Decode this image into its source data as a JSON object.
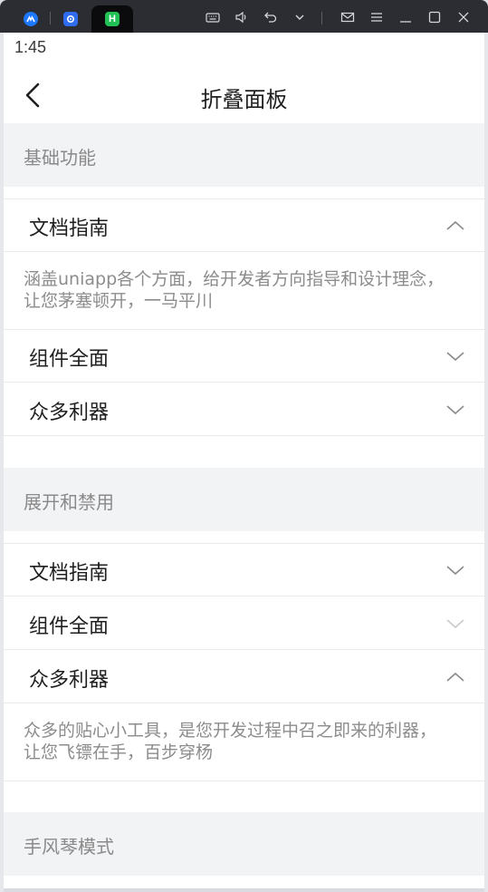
{
  "window": {
    "tab_active_letter": "H",
    "accent_colors": {
      "tab1": "#1e78ff",
      "tab2": "#2f6cf0",
      "tab3": "#21c156"
    }
  },
  "status": {
    "time": "1:45"
  },
  "navbar": {
    "title": "折叠面板"
  },
  "sections": [
    {
      "title": "基础功能",
      "items": [
        {
          "title": "文档指南",
          "expanded": true,
          "content": "涵盖uniapp各个方面，给开发者方向指导和设计理念，让您茅塞顿开，一马平川"
        },
        {
          "title": "组件全面",
          "expanded": false
        },
        {
          "title": "众多利器",
          "expanded": false
        }
      ]
    },
    {
      "title": "展开和禁用",
      "items": [
        {
          "title": "文档指南",
          "expanded": false
        },
        {
          "title": "组件全面",
          "expanded": false,
          "disabled": true
        },
        {
          "title": "众多利器",
          "expanded": true,
          "content": "众多的贴心小工具，是您开发过程中召之即来的利器，让您飞镖在手，百步穿杨"
        }
      ]
    },
    {
      "title": "手风琴模式",
      "items": []
    }
  ],
  "icons": {
    "back": "chevron-left-icon",
    "expand": "chevron-down-icon",
    "collapse": "chevron-up-icon"
  }
}
